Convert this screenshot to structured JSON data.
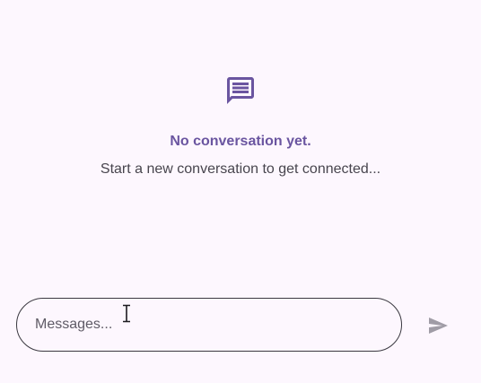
{
  "empty_state": {
    "icon": "chat-bubble-icon",
    "title": "No conversation yet.",
    "subtitle": "Start a new conversation to get connected..."
  },
  "composer": {
    "placeholder": "Messages...",
    "value": "",
    "send_icon": "send-icon"
  },
  "colors": {
    "background": "#fdf7fe",
    "accent": "#6a55a0",
    "send_disabled": "#a09ca6"
  }
}
